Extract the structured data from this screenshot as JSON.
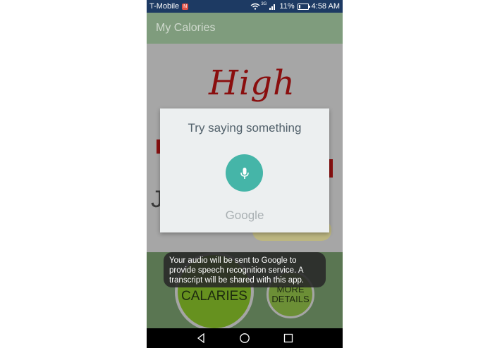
{
  "status_bar": {
    "carrier": "T-Mobile",
    "network": "3G",
    "battery": "11%",
    "time": "4:58 AM"
  },
  "app_bar": {
    "title": "My Calories"
  },
  "background": {
    "headline": "High",
    "calories_button_label": "CALARIES",
    "more_details_line1": "MORE",
    "more_details_line2": "DETAILS"
  },
  "dialog": {
    "prompt": "Try saying something",
    "brand": "Google",
    "mic_icon": "microphone-icon"
  },
  "toast": {
    "message": "Your audio will be sent to Google to provide speech recognition service. A transcript will be shared with this app."
  },
  "nav_bar": {
    "icons": [
      "back-icon",
      "home-icon",
      "recents-icon"
    ]
  },
  "colors": {
    "status_bar": "#1d3a63",
    "app_bar": "#7f9c7d",
    "mic_accent": "#45b5a8",
    "dialog_bg": "#eceff0"
  }
}
